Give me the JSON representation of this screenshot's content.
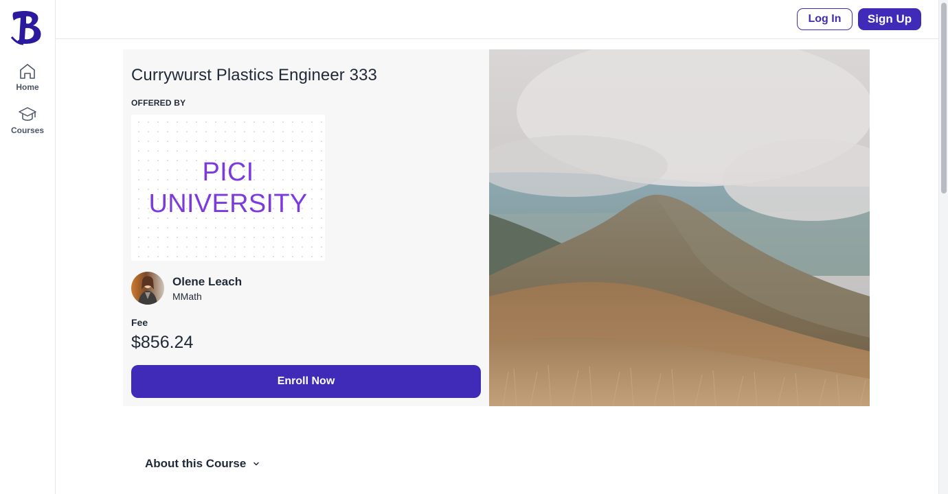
{
  "sidebar": {
    "logo_icon": "b-logo-icon",
    "items": [
      {
        "label": "Home",
        "icon": "home-icon"
      },
      {
        "label": "Courses",
        "icon": "graduation-cap-icon"
      }
    ]
  },
  "header": {
    "login_label": "Log In",
    "signup_label": "Sign Up"
  },
  "course": {
    "title": "Currywurst Plastics Engineer 333",
    "offered_by_label": "OFFERED BY",
    "provider": {
      "line1": "PICI",
      "line2": "UNIVERSITY"
    },
    "instructor": {
      "name": "Olene Leach",
      "degree": "MMath"
    },
    "fee_label": "Fee",
    "fee_value": "$856.24",
    "enroll_label": "Enroll Now"
  },
  "about": {
    "label": "About this Course",
    "icon": "chevron-down-icon"
  },
  "colors": {
    "brand": "#3f2bb8",
    "provider_text": "#7b3ae0",
    "card_bg": "#f7f7f8"
  }
}
